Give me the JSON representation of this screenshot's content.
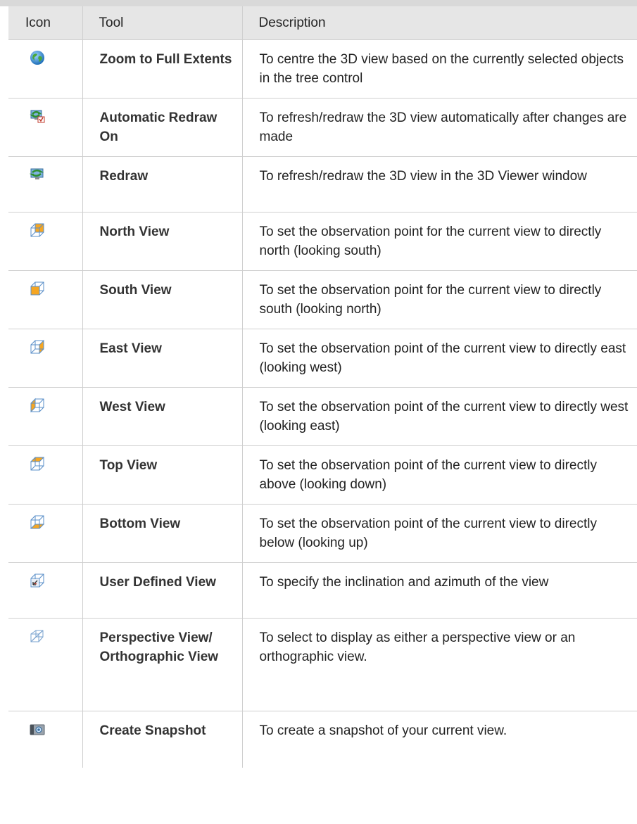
{
  "header": {
    "icon": "Icon",
    "tool": "Tool",
    "description": "Description"
  },
  "rows": [
    {
      "icon": "globe-icon",
      "tool": "Zoom to Full Extents",
      "description": "To centre the 3D view based on the currently selected objects in the tree control"
    },
    {
      "icon": "auto-redraw-icon",
      "tool": "Automatic Redraw On",
      "description": "To refresh/redraw the 3D view automatically after changes are made"
    },
    {
      "icon": "redraw-icon",
      "tool": "Redraw",
      "description": "To refresh/redraw the 3D view in the 3D Viewer window"
    },
    {
      "icon": "north-view-icon",
      "tool": "North View",
      "description": "To set the observation point for the current view to directly north (looking south)"
    },
    {
      "icon": "south-view-icon",
      "tool": "South View",
      "description": "To set the observation point for the current view to directly south (looking north)"
    },
    {
      "icon": "east-view-icon",
      "tool": "East View",
      "description": "To set the observation point of the current view to directly east (looking west)"
    },
    {
      "icon": "west-view-icon",
      "tool": "West View",
      "description": "To set the observation point of the current view to directly west (looking east)"
    },
    {
      "icon": "top-view-icon",
      "tool": "Top View",
      "description": "To set the observation point of the current view to directly above (looking down)"
    },
    {
      "icon": "bottom-view-icon",
      "tool": "Bottom View",
      "description": "To set the observation point of the current view to directly below (looking up)"
    },
    {
      "icon": "user-defined-view-icon",
      "tool": "User Defined View",
      "description": "To specify the inclination and azimuth of the view"
    },
    {
      "icon": "perspective-view-icon",
      "tool": "Perspective View/ Orthographic View",
      "description": "To select to display as either a perspective view or an orthographic view."
    },
    {
      "icon": "camera-icon",
      "tool": "Create Snapshot",
      "description": "To create a snapshot of your current view."
    }
  ],
  "colors": {
    "header_bg": "#e6e6e6",
    "border": "#d0d0d0",
    "cube_orange": "#f5a623",
    "cube_blue": "#5a8fc8"
  }
}
